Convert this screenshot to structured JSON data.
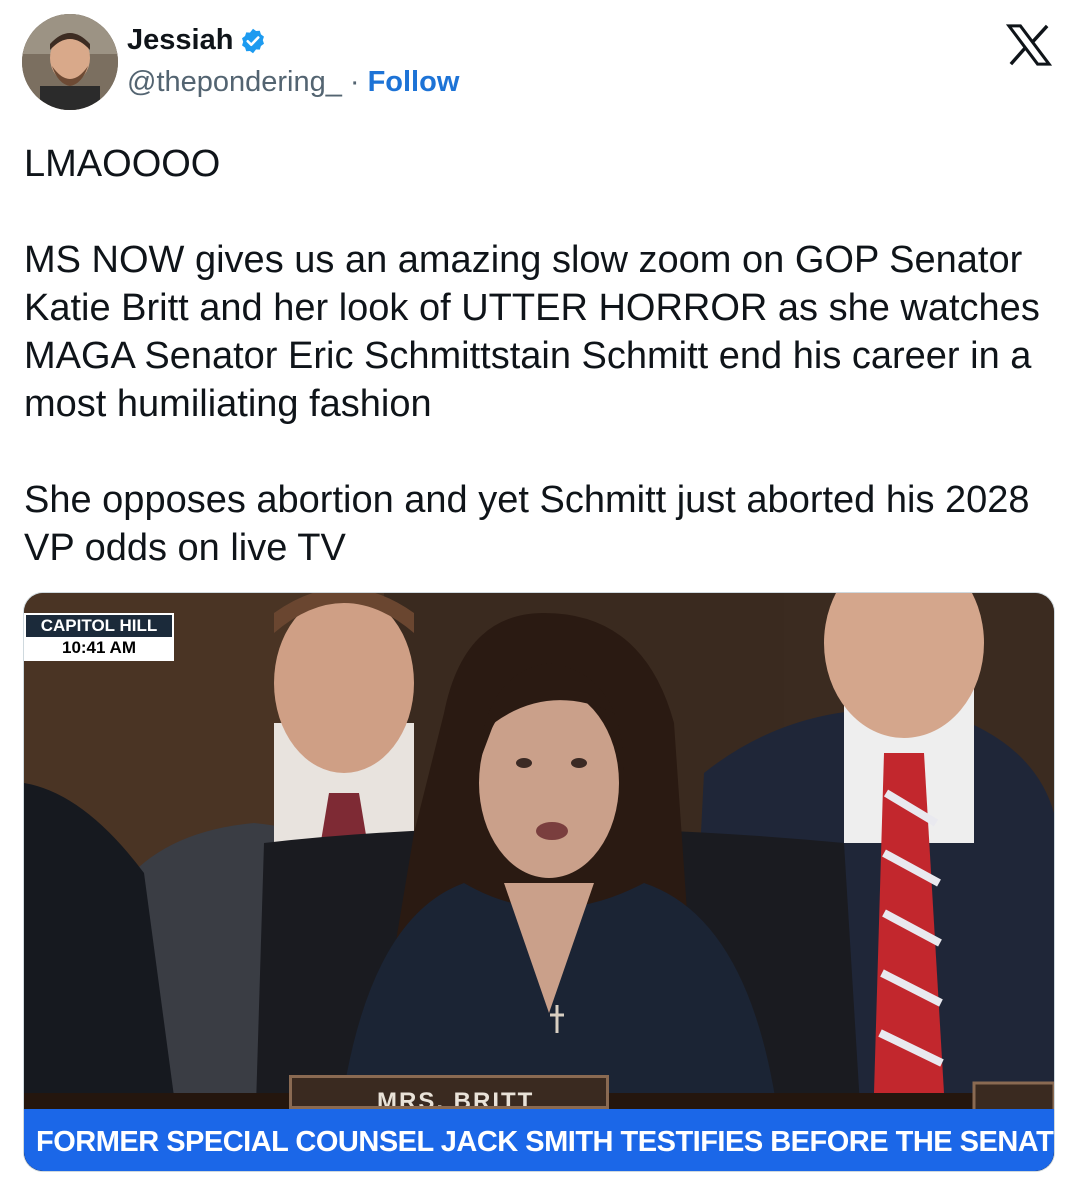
{
  "author": {
    "name": "Jessiah",
    "handle": "@thepondering_",
    "separator": "·",
    "follow_label": "Follow",
    "verified": true
  },
  "icons": {
    "avatar": "avatar",
    "verified": "verified-badge-icon",
    "platform": "x-logo-icon"
  },
  "tweet": {
    "text": "LMAOOOO\n\nMS NOW gives us an amazing slow zoom on GOP Senator Katie Britt and her look of UTTER HORROR as she watches MAGA Senator Eric Schmittstain Schmitt end his career in a most humiliating fashion\n\nShe opposes abortion and yet Schmitt just aborted his 2028 VP odds on live TV"
  },
  "media": {
    "bug_location": "CAPITOL HILL",
    "bug_time": "10:41 AM",
    "nameplate": "MRS. BRITT",
    "chyron": "FORMER SPECIAL COUNSEL JACK SMITH TESTIFIES BEFORE THE SENATE"
  },
  "colors": {
    "link": "#1d73d6",
    "verified": "#1d9bf0",
    "chyron": "#1b67e8",
    "text": "#0f1419",
    "secondary": "#536471"
  }
}
